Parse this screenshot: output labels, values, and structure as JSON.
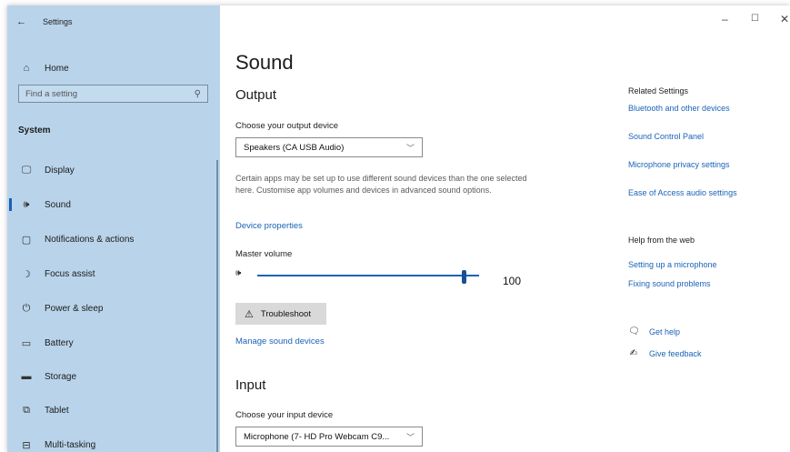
{
  "window": {
    "title": "Settings",
    "back_icon": "back-arrow-icon",
    "controls": {
      "minimize": "–",
      "maximize": "☐",
      "close": "✕"
    }
  },
  "sidebar": {
    "home_label": "Home",
    "search_placeholder": "Find a setting",
    "section_title": "System",
    "items": [
      {
        "label": "Display",
        "icon": "display-icon",
        "glyph": "🖵"
      },
      {
        "label": "Sound",
        "icon": "speaker-icon",
        "glyph": "🕪",
        "active": true
      },
      {
        "label": "Notifications & actions",
        "icon": "notification-icon",
        "glyph": "▢"
      },
      {
        "label": "Focus assist",
        "icon": "moon-icon",
        "glyph": "☽"
      },
      {
        "label": "Power & sleep",
        "icon": "power-icon",
        "glyph": "⏻"
      },
      {
        "label": "Battery",
        "icon": "battery-icon",
        "glyph": "▭"
      },
      {
        "label": "Storage",
        "icon": "storage-icon",
        "glyph": "▬"
      },
      {
        "label": "Tablet",
        "icon": "tablet-icon",
        "glyph": "⧉"
      },
      {
        "label": "Multi-tasking",
        "icon": "multitasking-icon",
        "glyph": "⊟"
      }
    ]
  },
  "main": {
    "title": "Sound",
    "output": {
      "heading": "Output",
      "choose_label": "Choose your output device",
      "device": "Speakers (CA USB Audio)",
      "description": "Certain apps may be set up to use different sound devices than the one selected here. Customise app volumes and devices in advanced sound options.",
      "device_properties": "Device properties",
      "master_volume_label": "Master volume",
      "volume": 100,
      "volume_text": "100",
      "troubleshoot": "Troubleshoot",
      "manage_devices": "Manage sound devices"
    },
    "input": {
      "heading": "Input",
      "choose_label": "Choose your input device",
      "device": "Microphone (7- HD Pro Webcam C9..."
    }
  },
  "related": {
    "heading": "Related Settings",
    "links": [
      "Bluetooth and other devices",
      "Sound Control Panel",
      "Microphone privacy settings",
      "Ease of Access audio settings"
    ],
    "help_heading": "Help from the web",
    "help_links": [
      "Setting up a microphone",
      "Fixing sound problems"
    ],
    "get_help": "Get help",
    "give_feedback": "Give feedback"
  },
  "colors": {
    "sidebar_bg": "#b9d4ea",
    "accent": "#1a63b8"
  }
}
